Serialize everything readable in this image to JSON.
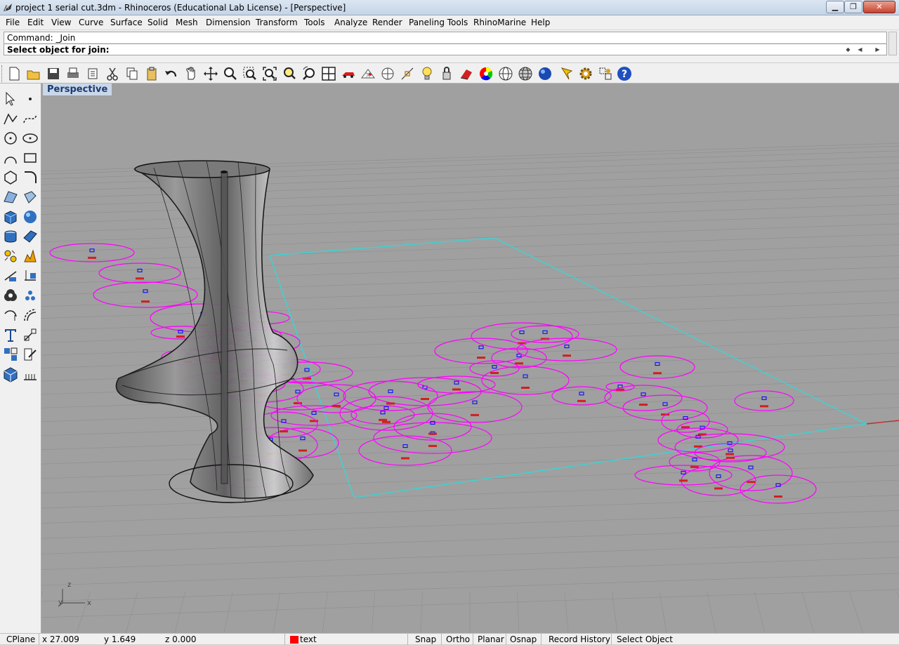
{
  "window": {
    "title": "project 1 serial cut.3dm - Rhinoceros (Educational Lab License) - [Perspective]"
  },
  "menu": [
    "File",
    "Edit",
    "View",
    "Curve",
    "Surface",
    "Solid",
    "Mesh",
    "Dimension",
    "Transform",
    "Tools",
    "Analyze",
    "Render",
    "Paneling Tools",
    "RhinoMarine",
    "Help"
  ],
  "command": {
    "history": "Command: _Join",
    "prompt": "Select object for join:"
  },
  "toolbar_icons": [
    "new-icon",
    "open-icon",
    "save-icon",
    "print-icon",
    "cut-props-icon",
    "cut-icon",
    "copy-icon",
    "paste-icon",
    "undo-icon",
    "pan-icon",
    "rotate-view-icon",
    "zoom-dynamic-icon",
    "zoom-window-icon",
    "zoom-extents-icon",
    "zoom-selected-icon",
    "undo-view-icon",
    "four-viewports-icon",
    "car-icon",
    "grid-snap-icon",
    "cplane-icon",
    "osnap-icon",
    "light-bulb-icon",
    "light-bulb2-icon",
    "lock-icon",
    "color-picker-icon",
    "color-wheel-icon",
    "wireframe-display-icon",
    "ghosted-display-icon",
    "rendered-display-icon",
    "material-icon",
    "options-gear-icon",
    "grid-options-icon",
    "help-icon"
  ],
  "left_tool_icons": [
    "select-icon",
    "point-icon",
    "polyline-icon",
    "curve-icon",
    "circle-icon",
    "arc-icon",
    "ellipse-icon",
    "rectangle-icon",
    "polygon-icon",
    "fillet-icon",
    "surface-corner-icon",
    "extrude-icon",
    "box-icon",
    "sphere-icon",
    "cylinder-icon",
    "surface-patch-icon",
    "mesh-icon",
    "explode-icon",
    "split-icon",
    "trim-icon",
    "boolean-icon",
    "array-icon",
    "rotate-icon",
    "offset-icon",
    "text-icon",
    "dimension-icon",
    "group-icon",
    "move-icon",
    "solid-box-icon",
    "hatch-icon"
  ],
  "viewport": {
    "label": "Perspective",
    "axis_z": "z",
    "axis_y": "y",
    "axis_x": "x"
  },
  "status": {
    "cplane": "CPlane",
    "x": "x 27.009",
    "y": "y 1.649",
    "z": "z 0.000",
    "layer": "text",
    "layer_color": "#ff0000",
    "snap": "Snap",
    "ortho": "Ortho",
    "planar": "Planar",
    "osnap": "Osnap",
    "record_history": "Record History",
    "select_object": "Select Object"
  }
}
